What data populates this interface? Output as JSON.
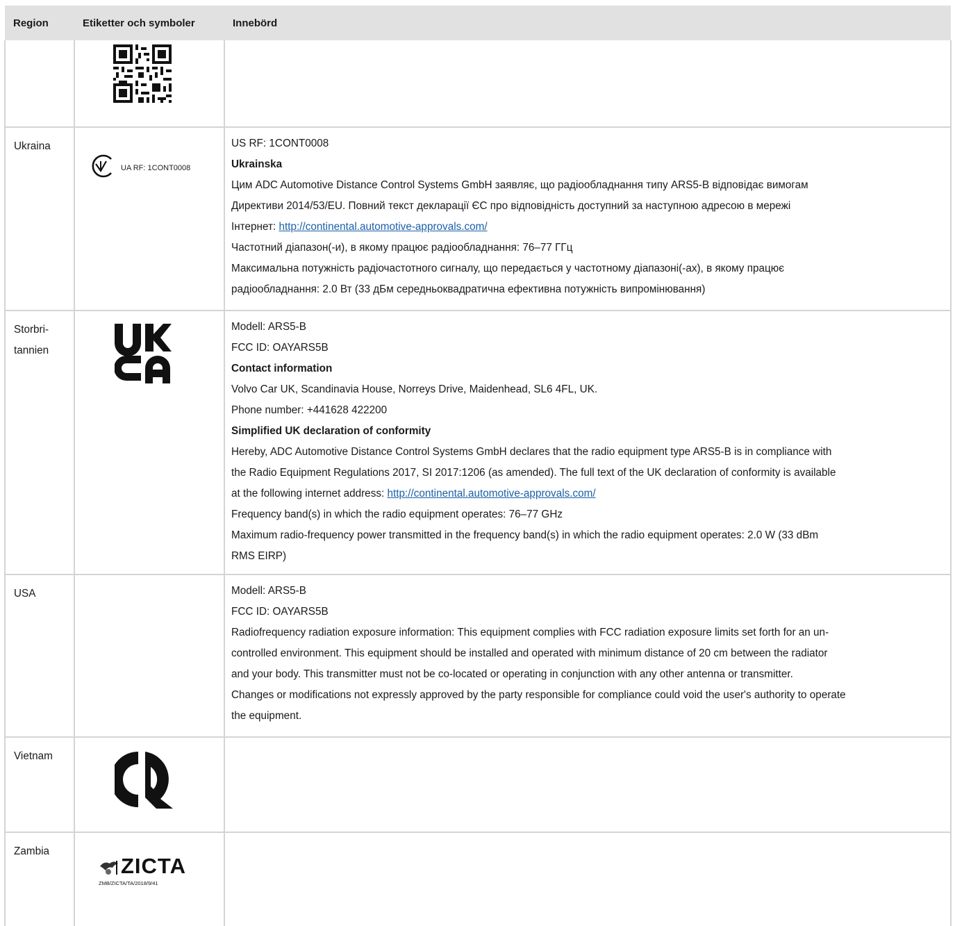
{
  "header": {
    "region": "Region",
    "symbols": "Etiketter och symboler",
    "meaning": "Innebörd"
  },
  "rows": {
    "qr": {
      "region": "",
      "content": []
    },
    "ukraina": {
      "region": "Ukraina",
      "symbol_text": "UA RF: 1CONT0008",
      "symbol_icon": "ukrainian-conformity-mark",
      "lines": [
        "US RF: 1CONT0008",
        "Ukrainska",
        "Цим ADC Automotive Distance Control Systems GmbH заявляє, що радіообладнання типу ARS5-B відповідає вимогам",
        "Директиви 2014/53/EU. Повний текст декларації ЄС про відповідність доступний за наступною адресою в мережі",
        "Інтернет: ",
        "http://continental.automotive-approvals.com/",
        "Частотний діапазон(-и), в якому працює радіообладнання: 76–77 ГГц",
        "Максимальна потужність радіочастотного сигналу, що передається у частотному діапазоні(-ах), в якому працює",
        "радіообладнання: 2.0 Вт (33 дБм середньоквадратична ефективна потужність випромінювання)"
      ]
    },
    "storbritannien": {
      "region_line1": "Storbri-",
      "region_line2": "tannien",
      "symbol_icon": "ukca-mark",
      "lines": [
        "Modell: ARS5-B",
        "FCC ID: OAYARS5B",
        "Contact information",
        "Volvo Car UK, Scandinavia House, Norreys Drive, Maidenhead, SL6 4FL, UK.",
        "Phone number: +441628 422200",
        "Simplified UK declaration of conformity",
        "Hereby, ADC Automotive Distance Control Systems GmbH declares that the radio equipment type ARS5-B is in compliance with",
        "the Radio Equipment Regulations 2017, SI 2017:1206 (as amended). The full text of the UK declaration of conformity is available",
        "at the following internet address: ",
        "http://continental.automotive-approvals.com/",
        "Frequency band(s) in which the radio equipment operates: 76–77 GHz",
        "Maximum radio-frequency power transmitted in the frequency band(s) in which the radio equipment operates: 2.0 W (33 dBm",
        "RMS EIRP)"
      ]
    },
    "usa": {
      "region": "USA",
      "lines": [
        "Modell: ARS5-B",
        "FCC ID: OAYARS5B",
        "Radiofrequency radiation exposure information: This equipment complies with FCC radiation exposure limits set forth for an un-",
        "controlled environment. This equipment should be installed and operated with minimum distance of 20 cm between the radiator",
        "and your body. This transmitter must not be co-located or operating in conjunction with any other antenna or transmitter.",
        "Changes or modifications not expressly approved by the party responsible for compliance could void the user's authority to operate",
        "the equipment."
      ]
    },
    "vietnam": {
      "region": "Vietnam",
      "symbol_icon": "vietnam-cr-mark"
    },
    "zambia": {
      "region": "Zambia",
      "symbol_word": "ZICTA",
      "symbol_code": "ZMB/ZICTA/TA/2018/9/41",
      "symbol_icon": "zicta-logo"
    }
  }
}
